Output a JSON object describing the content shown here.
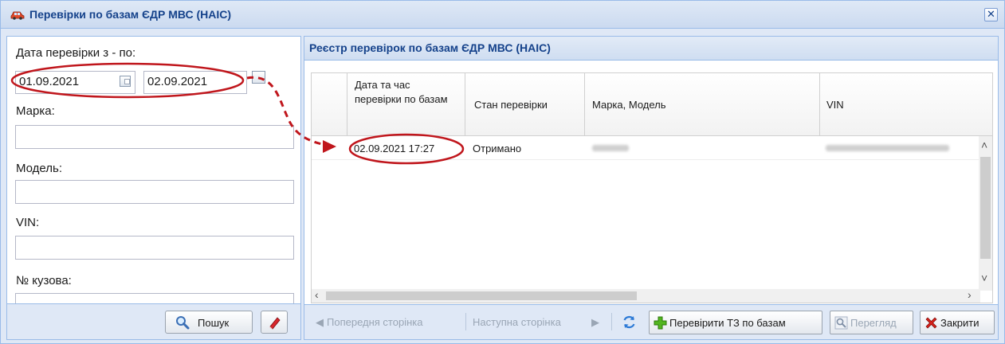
{
  "window": {
    "title": "Перевірки по базам ЄДР МВС (НАІС)",
    "close_glyph": "✕"
  },
  "filters": {
    "date_label": "Дата перевірки з - по:",
    "date_from": "01.09.2021",
    "date_to": "02.09.2021",
    "brand_label": "Марка:",
    "brand_value": "",
    "model_label": "Модель:",
    "model_value": "",
    "vin_label": "VIN:",
    "vin_value": "",
    "body_label": "№ кузова:",
    "search_button": "Пошук"
  },
  "registry": {
    "title": "Реєстр перевірок по базам ЄДР МВС (НАІС)",
    "columns": [
      "Дата та час перевірки по базам",
      "Стан перевірки",
      "Марка, Модель",
      "VIN"
    ],
    "rows": [
      {
        "datetime": "02.09.2021 17:27",
        "status": "Отримано",
        "model": "",
        "vin": ""
      }
    ]
  },
  "toolbar": {
    "prev_page": "Попередня сторінка",
    "next_page": "Наступна сторінка",
    "check_button": "Перевірити ТЗ по базам",
    "view_button": "Перегляд",
    "close_button": "Закрити"
  },
  "colors": {
    "header_text": "#15428b",
    "border": "#99bbe8",
    "panel_bg": "#dfe8f6",
    "annotation": "#c0161c"
  },
  "icons": {
    "app": "car-icon",
    "calendar": "calendar-icon",
    "search": "magnifier-icon",
    "clear": "eraser-icon",
    "refresh": "refresh-icon",
    "add": "green-plus-icon",
    "view": "magnifier-icon",
    "close": "red-x-icon"
  }
}
